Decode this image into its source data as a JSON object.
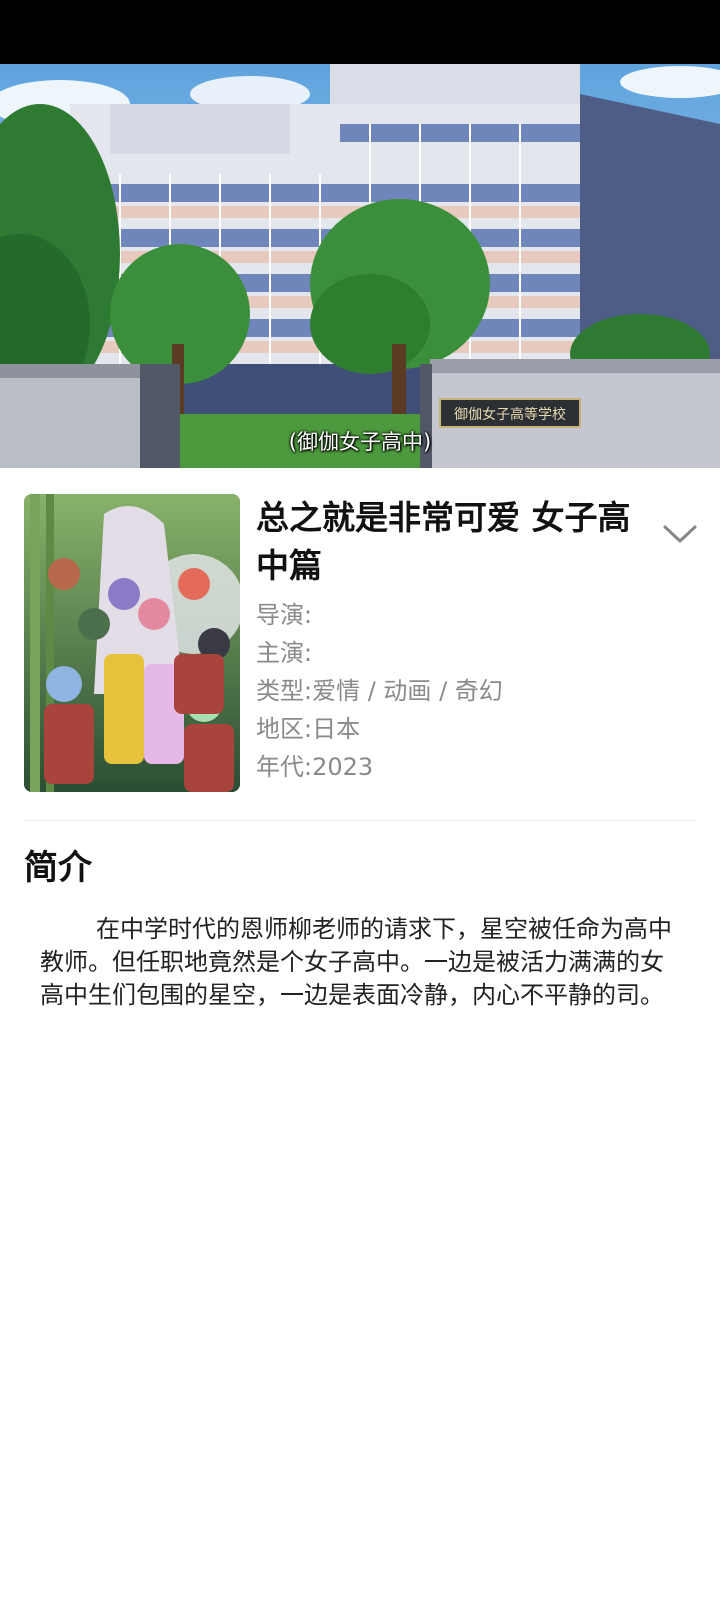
{
  "video": {
    "subtitle": "(御伽女子高中)",
    "gate_sign": "御伽女子高等学校"
  },
  "show": {
    "title": "总之就是非常可爱 女子高中篇",
    "meta": [
      {
        "label": "导演:",
        "value": ""
      },
      {
        "label": "主演:",
        "value": ""
      },
      {
        "label": "类型:",
        "value": "爱情 / 动画 / 奇幻"
      },
      {
        "label": "地区:",
        "value": "日本"
      },
      {
        "label": "年代:",
        "value": "2023"
      }
    ]
  },
  "intro": {
    "heading": "简介",
    "body": "在中学时代的恩师柳老师的请求下，星空被任命为高中教师。但任职地竟然是个女子高中。一边是被活力满满的女高中生们包围的星空，一边是表面冷静，内心不平静的司。"
  },
  "icons": {
    "expand": "chevron-down-icon"
  },
  "colors": {
    "status_bar": "#000000",
    "title": "#111111",
    "meta_text": "#8a8a8a",
    "body_text": "#222222",
    "divider": "#ececec"
  }
}
